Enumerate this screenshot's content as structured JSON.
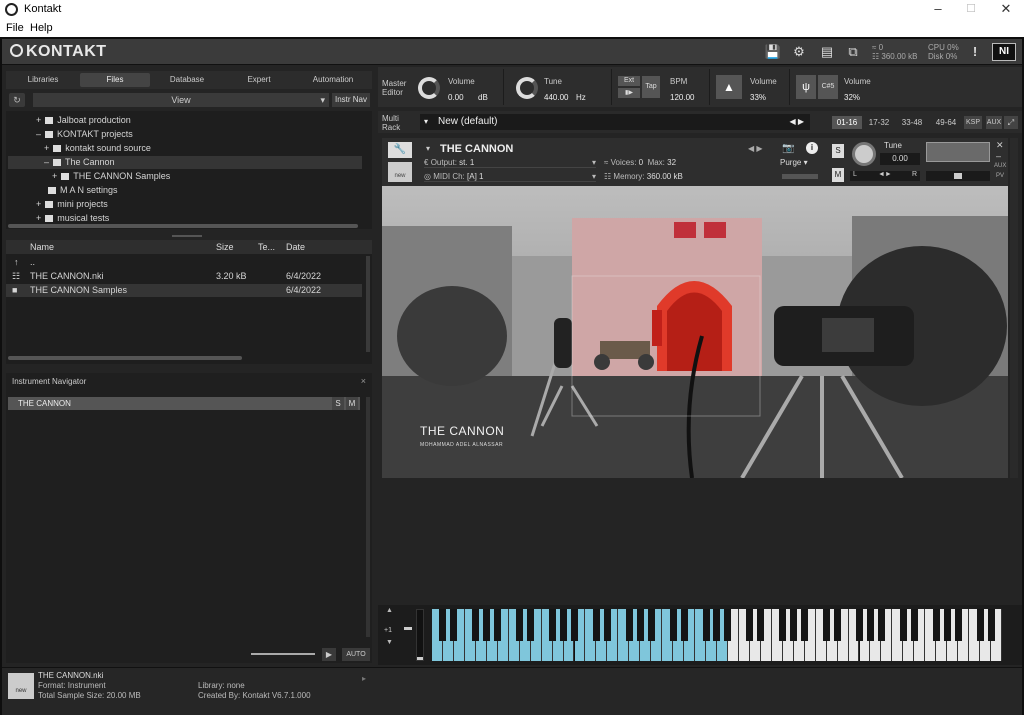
{
  "window": {
    "title": "Kontakt",
    "minimize": "–",
    "maximize": "☐",
    "close": "✕"
  },
  "menu": [
    "File",
    "Help"
  ],
  "topbar": {
    "logo": "KONTAKT",
    "stats_left": [
      "0",
      "360.00 kB"
    ],
    "cpu_label": "CPU",
    "cpu_value": "0%",
    "disk_label": "Disk",
    "disk_value": "0%",
    "ni": "NI"
  },
  "browser": {
    "tabs": [
      "Libraries",
      "Files",
      "Database",
      "Expert",
      "Automation"
    ],
    "active_tab": "Files",
    "view_label": "View",
    "instr_nav_label": "Instr Nav",
    "tree": [
      {
        "label": "Jalboat production",
        "indent": 1,
        "toggle": "+"
      },
      {
        "label": "KONTAKT projects",
        "indent": 1,
        "toggle": "–"
      },
      {
        "label": "kontakt sound source",
        "indent": 2,
        "toggle": "+"
      },
      {
        "label": "The Cannon",
        "indent": 2,
        "toggle": "–",
        "selected": true
      },
      {
        "label": "THE CANNON Samples",
        "indent": 3,
        "toggle": "+"
      },
      {
        "label": "M A N settings",
        "indent": 1,
        "toggle": ""
      },
      {
        "label": "mini projects",
        "indent": 1,
        "toggle": "+"
      },
      {
        "label": "musical tests",
        "indent": 1,
        "toggle": "+"
      }
    ],
    "file_columns": [
      "Name",
      "Size",
      "Te...",
      "Date"
    ],
    "files": [
      {
        "name": "..",
        "size": "",
        "type": "",
        "date": ""
      },
      {
        "name": "THE CANNON.nki",
        "size": "3.20 kB",
        "type": "",
        "date": "6/4/2022"
      },
      {
        "name": "THE CANNON Samples",
        "size": "",
        "type": "",
        "date": "6/4/2022",
        "selected": true
      }
    ]
  },
  "navigator": {
    "title": "Instrument Navigator",
    "close": "×",
    "item": "THE CANNON",
    "s": "S",
    "m": "M",
    "auto": "AUTO"
  },
  "footer": {
    "newicon": "new",
    "filename": "THE CANNON.nki",
    "format": "Format: Instrument",
    "sample_size": "Total Sample Size: 20.00 MB",
    "library": "Library: none",
    "created_by": "Created By: Kontakt V6.7.1.000"
  },
  "master": {
    "label1": "Master",
    "label2": "Editor",
    "volume_label": "Volume",
    "volume_value": "0.00",
    "volume_unit": "dB",
    "tune_label": "Tune",
    "tune_value": "440.00",
    "tune_unit": "Hz",
    "ext": "Ext",
    "tap": "Tap",
    "bpm_label": "BPM",
    "bpm_value": "120.00",
    "metro_volume_label": "Volume",
    "metro_volume_value": "33%",
    "ref_key": "C#5",
    "ref_volume_label": "Volume",
    "ref_volume_value": "32%"
  },
  "rack": {
    "label1": "Multi",
    "label2": "Rack",
    "name": "New (default)",
    "pages": [
      "01-16",
      "17-32",
      "33-48",
      "49-64"
    ],
    "active_page": "01-16",
    "ksp": "KSP",
    "aux": "AUX"
  },
  "instrument": {
    "name": "THE CANNON",
    "output_label": "Output:",
    "output_value": "st. 1",
    "midi_label": "MIDI Ch:",
    "midi_value": "[A] 1",
    "voices_label": "Voices:",
    "voices_value": "0",
    "max_label": "Max:",
    "max_value": "32",
    "memory_label": "Memory:",
    "memory_value": "360.00 kB",
    "purge": "Purge",
    "s": "S",
    "m": "M",
    "tune_label": "Tune",
    "tune_value": "0.00",
    "pan_l": "L",
    "pan_r": "R",
    "aux": "AUX",
    "pv": "PV",
    "newbox": "new",
    "photo_title": "THE CANNON",
    "photo_subtitle": "MOHAMMAD ADEL ALNASSAR"
  },
  "keyboard": {
    "octave": "+1"
  }
}
